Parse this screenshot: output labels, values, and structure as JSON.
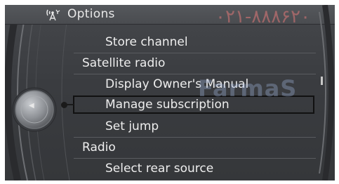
{
  "header": {
    "icon": "satellite-antenna-icon",
    "title": "Options"
  },
  "menu": {
    "items": [
      {
        "label": "Store channel",
        "level": "sub"
      },
      {
        "label": "Satellite radio",
        "level": "heading"
      },
      {
        "label": "Display Owner's Manual",
        "level": "sub"
      },
      {
        "label": "Manage subscription",
        "level": "sub",
        "selected": true
      },
      {
        "label": "Set jump",
        "level": "sub"
      },
      {
        "label": "Radio",
        "level": "heading"
      },
      {
        "label": "Select rear source",
        "level": "sub"
      }
    ]
  },
  "controller": {
    "icon": "left-arrow-icon"
  },
  "watermark": {
    "phone": "۰۲۱-۸۸۸۶۲۰",
    "brand": "FarmaS"
  },
  "colors": {
    "background": "#3a3c40",
    "text": "#eeeeee",
    "highlight_border": "#111111"
  }
}
